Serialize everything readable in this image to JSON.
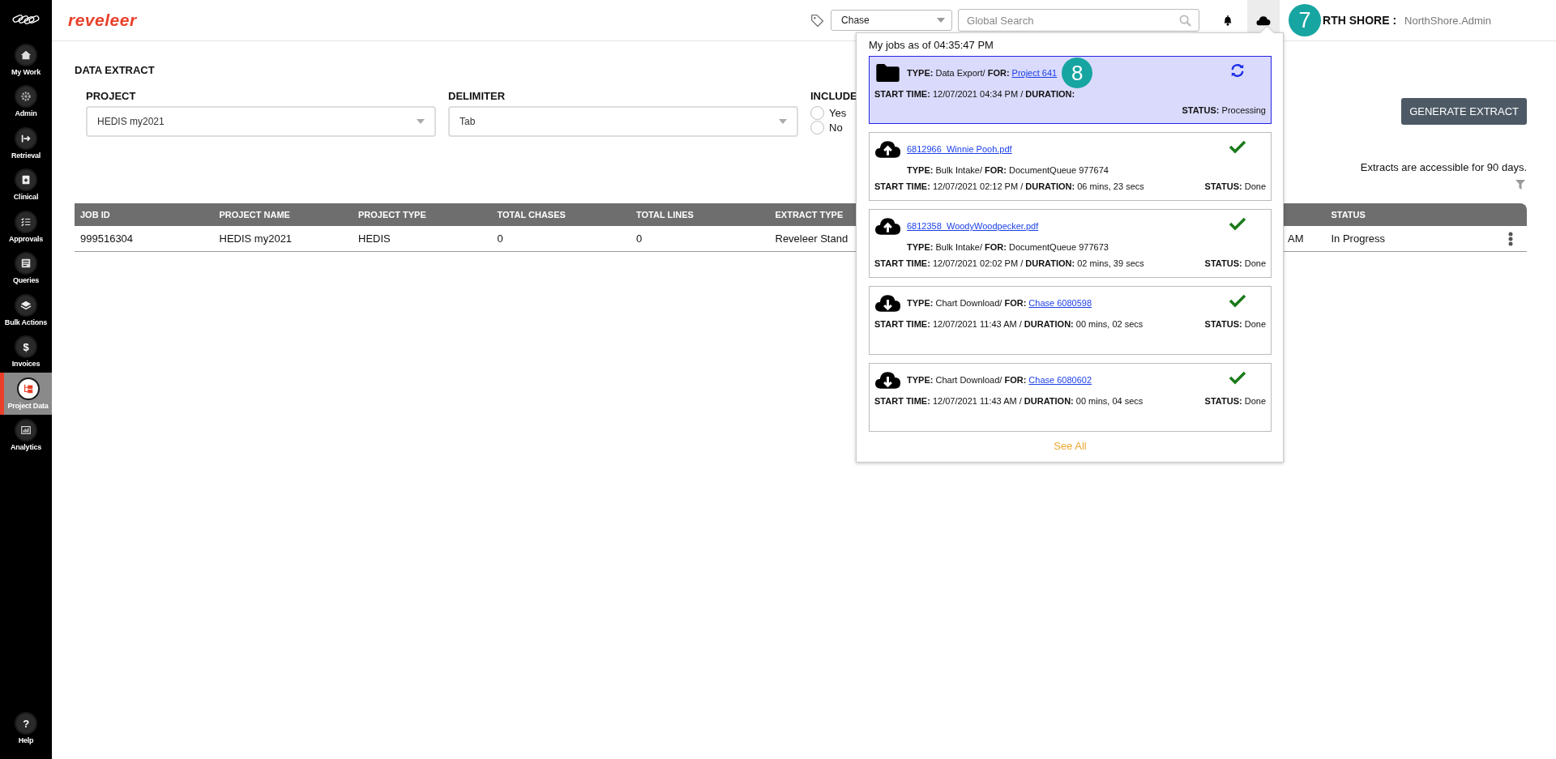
{
  "sidebar": {
    "items": [
      {
        "label": "My Work",
        "kind": "home",
        "selected": false
      },
      {
        "label": "Admin",
        "kind": "gear",
        "selected": false
      },
      {
        "label": "Retrieval",
        "kind": "arrow",
        "selected": false
      },
      {
        "label": "Clinical",
        "kind": "clipboard",
        "selected": false
      },
      {
        "label": "Approvals",
        "kind": "checklist",
        "selected": false
      },
      {
        "label": "Queries",
        "kind": "document",
        "selected": false
      },
      {
        "label": "Bulk Actions",
        "kind": "layers",
        "selected": false
      },
      {
        "label": "Invoices",
        "kind": "glyph",
        "glyph": "$",
        "selected": false
      },
      {
        "label": "Project Data",
        "kind": "tree",
        "selected": true
      },
      {
        "label": "Analytics",
        "kind": "chart",
        "selected": false
      }
    ],
    "help": {
      "label": "Help",
      "glyph": "?"
    }
  },
  "header": {
    "logo": "reveleer",
    "chase_select": "Chase",
    "search": {
      "placeholder": "Global Search"
    },
    "badge": "7",
    "org": "RTH SHORE :",
    "user": "NorthShore.Admin"
  },
  "page": {
    "title": "DATA EXTRACT",
    "project": {
      "label": "PROJECT",
      "value": "HEDIS my2021"
    },
    "delimiter": {
      "label": "DELIMITER",
      "value": "Tab"
    },
    "include": {
      "label": "INCLUDE",
      "options": [
        {
          "label": "Yes",
          "selected": false
        },
        {
          "label": "No",
          "selected": false
        }
      ]
    },
    "generate_button": "GENERATE EXTRACT",
    "note": "Extracts are accessible for 90 days.",
    "table": {
      "columns": [
        "JOB ID",
        "PROJECT NAME",
        "PROJECT TYPE",
        "TOTAL CHASES",
        "TOTAL LINES",
        "EXTRACT TYPE",
        "",
        "",
        "",
        "STATUS"
      ],
      "rows": [
        {
          "cells": [
            "999516304",
            "HEDIS my2021",
            "HEDIS",
            "0",
            "0",
            "Reveleer Stand",
            "",
            "",
            "AM",
            "In Progress"
          ]
        }
      ]
    }
  },
  "jobs_popup": {
    "title": "My jobs as of 04:35:47 PM",
    "see_all": "See All",
    "jobs": [
      {
        "kind": "folder",
        "processing": true,
        "type": "**TYPE:** Data Export/ **FOR:**",
        "link": "Project 641",
        "badge": "8",
        "start": "**START TIME:** 12/07/2021 04:34 PM / **DURATION:**",
        "status": "**STATUS:** Processing"
      },
      {
        "kind": "upload",
        "processing": false,
        "file": "6812966_Winnie Pooh.pdf",
        "type": "**TYPE:** Bulk Intake/ **FOR:** DocumentQueue 977674",
        "start": "**START TIME:** 12/07/2021 02:12 PM / **DURATION:** 06 mins, 23 secs",
        "status": "**STATUS:** Done"
      },
      {
        "kind": "upload",
        "processing": false,
        "file": "6812358_WoodyWoodpecker.pdf",
        "type": "**TYPE:** Bulk Intake/ **FOR:** DocumentQueue 977673",
        "start": "**START TIME:** 12/07/2021 02:02 PM / **DURATION:** 02 mins, 39 secs",
        "status": "**STATUS:** Done"
      },
      {
        "kind": "download",
        "processing": false,
        "type": "**TYPE:** Chart Download/ **FOR:**",
        "link": "Chase 6080598",
        "start": "**START TIME:** 12/07/2021 11:43 AM / **DURATION:** 00 mins, 02 secs",
        "status": "**STATUS:** Done"
      },
      {
        "kind": "download",
        "processing": false,
        "type": "**TYPE:** Chart Download/ **FOR:**",
        "link": "Chase 6080602",
        "start": "**START TIME:** 12/07/2021 11:43 AM / **DURATION:** 00 mins, 04 secs",
        "status": "**STATUS:** Done"
      }
    ]
  }
}
